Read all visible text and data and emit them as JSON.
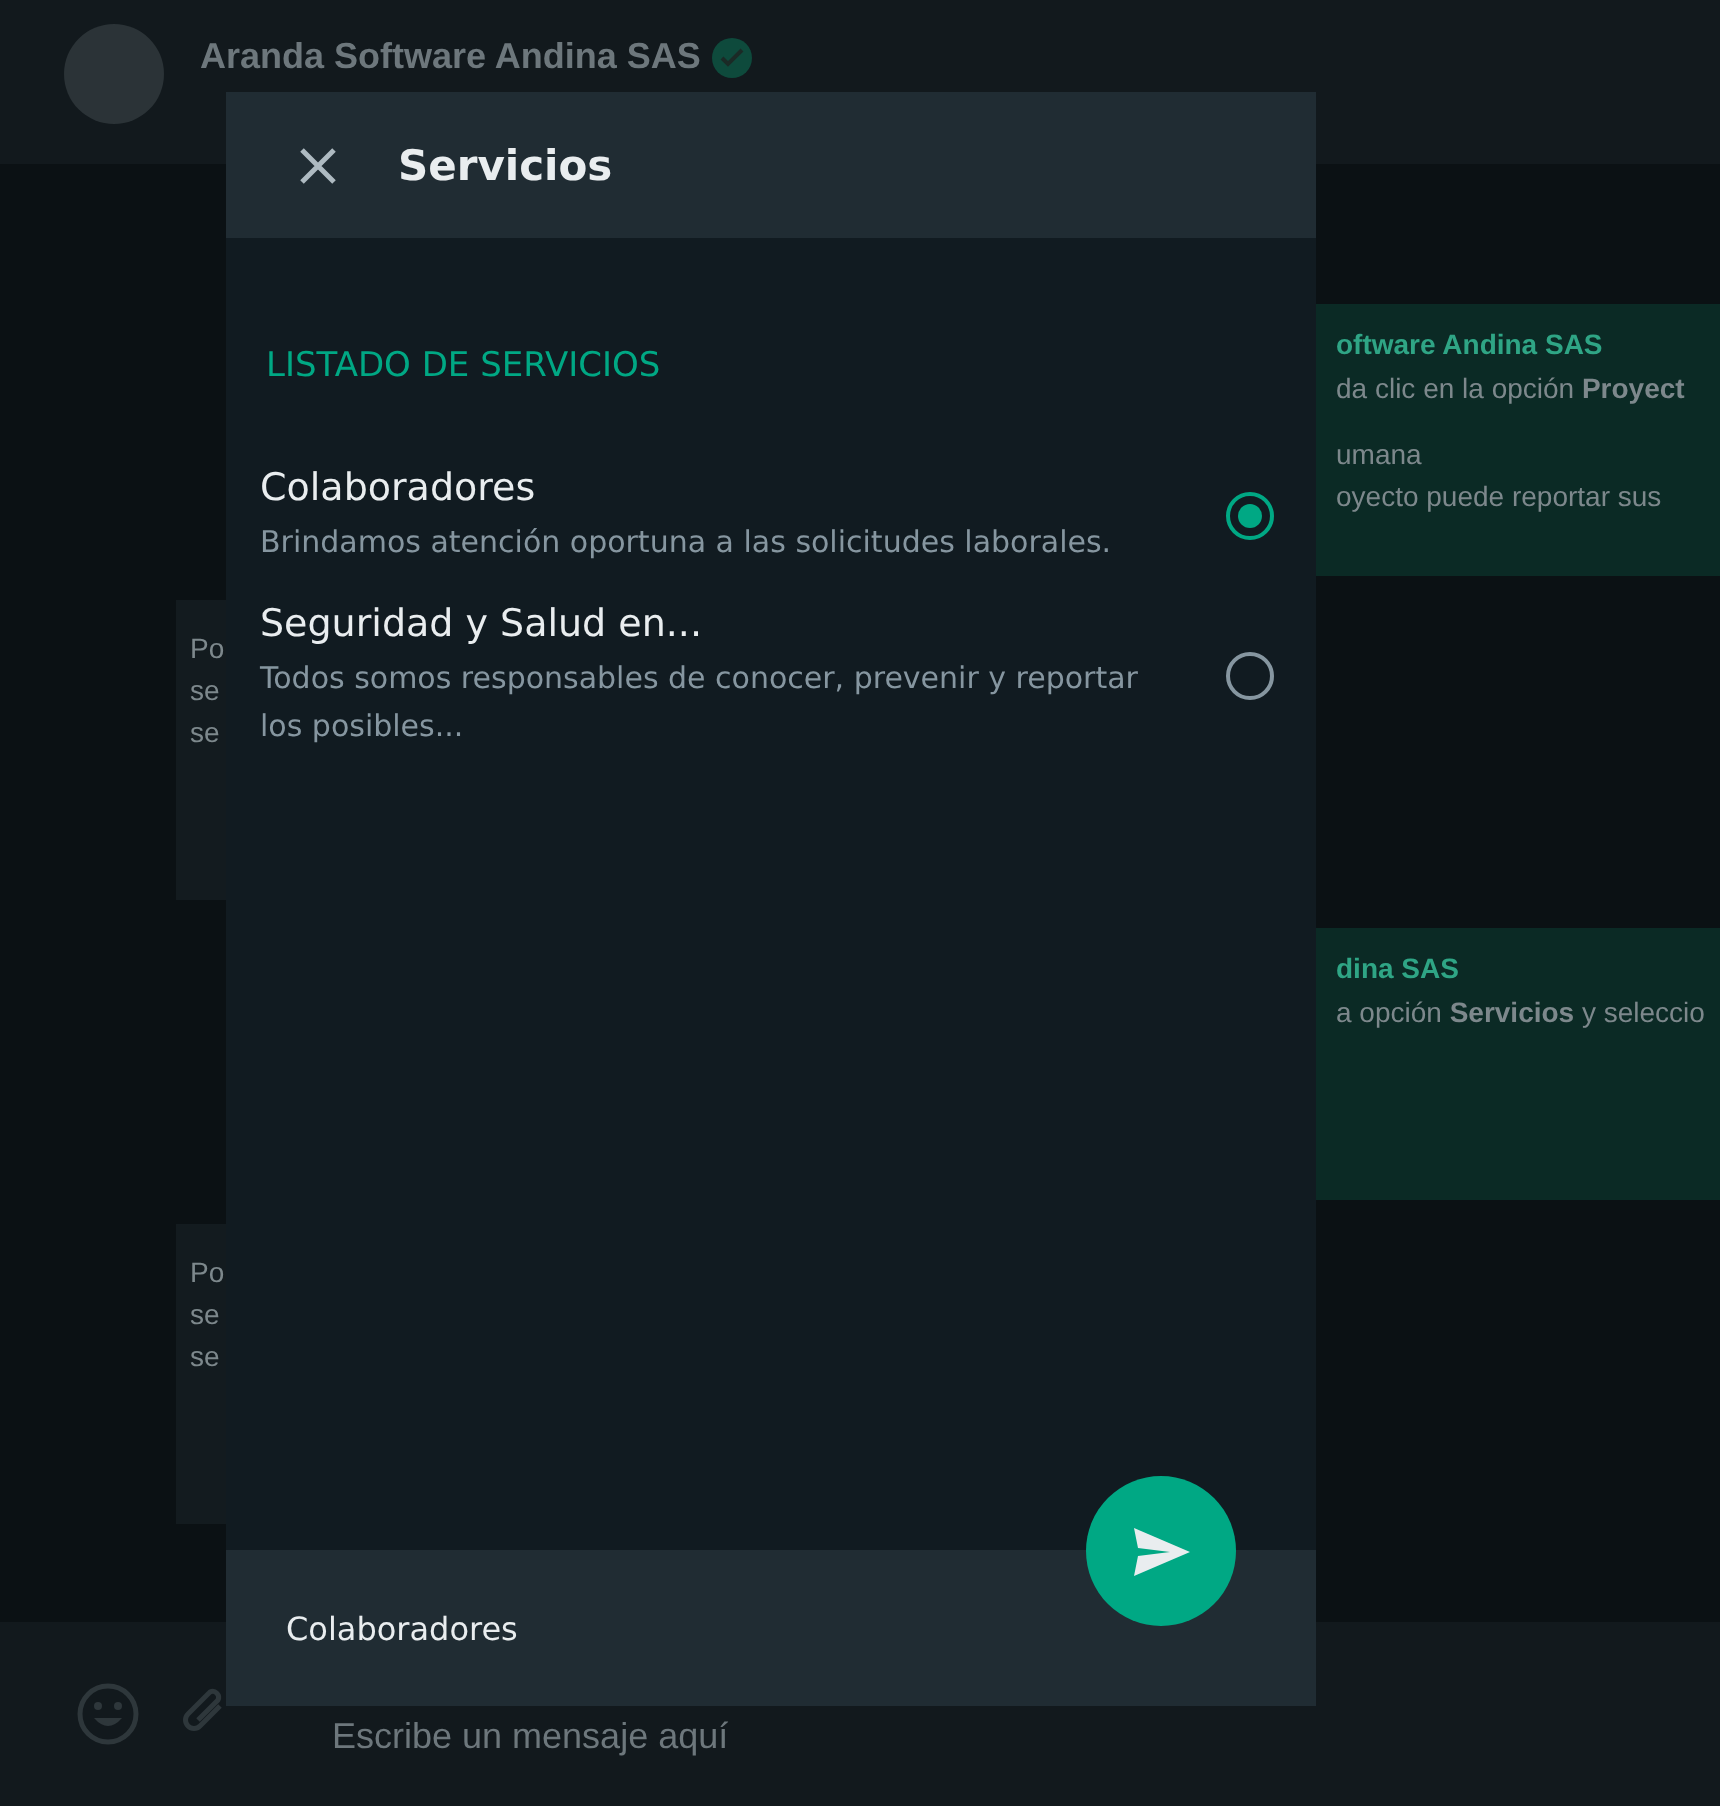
{
  "chat": {
    "contact": {
      "name": "Aranda Software Andina SAS",
      "verified": true
    },
    "messages": [
      {
        "kind": "outgoing",
        "sender": "oftware Andina SAS",
        "paragraphs": [
          [
            "da clic en la opción **Proyect**"
          ],
          [
            "umana",
            "oyecto puede reportar sus"
          ]
        ]
      },
      {
        "kind": "incoming",
        "paragraphs": [
          [
            "Po",
            "se",
            "se"
          ]
        ]
      },
      {
        "kind": "outgoing",
        "sender": "dina SAS",
        "paragraphs": [
          [
            "a opción **Servicios** y seleccio"
          ]
        ]
      },
      {
        "kind": "incoming",
        "paragraphs": [
          [
            "Po",
            "se",
            "se"
          ]
        ]
      }
    ],
    "composer": {
      "placeholder": "Escribe un mensaje aquí"
    }
  },
  "dialog": {
    "title": "Servicios",
    "section": "LISTADO DE SERVICIOS",
    "options": [
      {
        "title": "Colaboradores",
        "description": "Brindamos atención oportuna a las solicitudes laborales.",
        "selected": true
      },
      {
        "title": "Seguridad y Salud en...",
        "description": "Todos somos responsables de conocer, prevenir y reportar los posibles...",
        "selected": false
      }
    ],
    "footer": {
      "selection": "Colaboradores"
    }
  }
}
